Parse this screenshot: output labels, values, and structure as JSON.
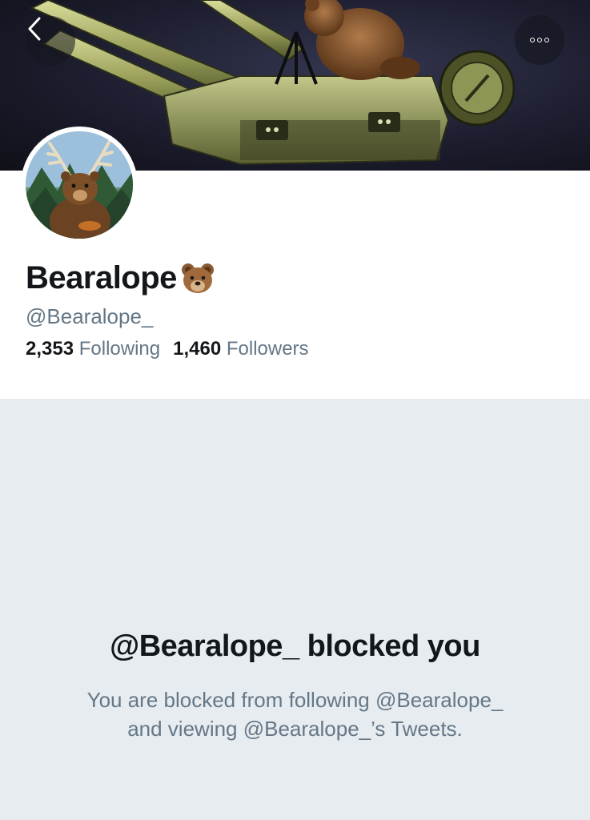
{
  "header": {
    "back_icon": "chevron-left-icon",
    "more_icon": "more-horizontal-icon",
    "banner_image": "bear on artillery cannon illustration"
  },
  "profile": {
    "display_name": "Bearalope",
    "display_name_emoji": "bear-face-emoji",
    "handle": "@Bearalope_",
    "following_count": "2,353",
    "following_label": "Following",
    "followers_count": "1,460",
    "followers_label": "Followers",
    "avatar_image": "bear with antlers in forest"
  },
  "blocked": {
    "title": "@Bearalope_ blocked you",
    "line1": "You are blocked from following @Bearalope_",
    "line2": "and viewing @Bearalope_’s Tweets."
  },
  "colors": {
    "text_primary": "#14171a",
    "text_secondary": "#657786",
    "background": "#e6ecf0",
    "card": "#ffffff"
  }
}
